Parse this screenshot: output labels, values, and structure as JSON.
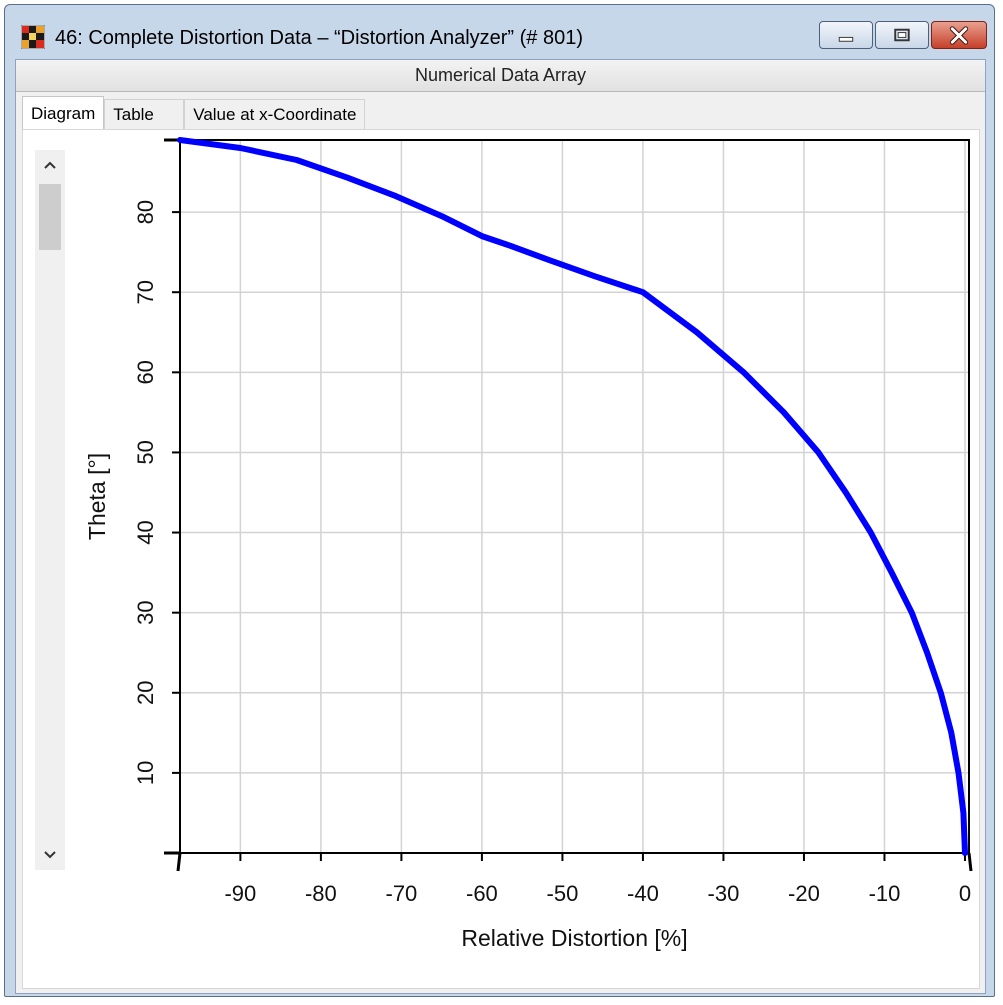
{
  "window": {
    "title": "46: Complete Distortion Data – “Distortion Analyzer” (# 801)",
    "header": "Numerical Data Array",
    "controls": [
      "minimize-icon",
      "restore-icon",
      "close-icon"
    ]
  },
  "tabs": [
    {
      "label": "Diagram",
      "active": true
    },
    {
      "label": "Table",
      "active": false
    },
    {
      "label": "Value at x-Coordinate",
      "active": false
    }
  ],
  "colors": {
    "curve": "#0000ff",
    "grid": "#d3d3d3",
    "axis": "#000000"
  },
  "chart_data": {
    "type": "line",
    "title": "",
    "xlabel": "Relative Distortion [%]",
    "ylabel": "Theta [°]",
    "xlim": [
      -97.5,
      0.5
    ],
    "ylim": [
      0,
      89
    ],
    "xticks": [
      -90,
      -80,
      -70,
      -60,
      -50,
      -40,
      -30,
      -20,
      -10,
      0
    ],
    "yticks": [
      10,
      20,
      30,
      40,
      50,
      60,
      70,
      80
    ],
    "grid": true,
    "series": [
      {
        "color": "#0000ff",
        "x": [
          0,
          -0.2,
          -0.8,
          -1.7,
          -3,
          -4.7,
          -6.6,
          -9.1,
          -11.7,
          -14.8,
          -18.2,
          -22.5,
          -27.5,
          -33.3,
          -40,
          -46,
          -51.6,
          -56.5,
          -60,
          -65,
          -70.7,
          -76.7,
          -83,
          -90,
          -97.5
        ],
        "y": [
          0,
          5,
          10,
          15,
          20,
          25,
          30,
          35,
          40,
          45,
          50,
          55,
          60,
          65,
          70,
          72,
          74,
          75.8,
          77,
          79.5,
          82,
          84.3,
          86.5,
          88,
          89
        ]
      }
    ]
  }
}
